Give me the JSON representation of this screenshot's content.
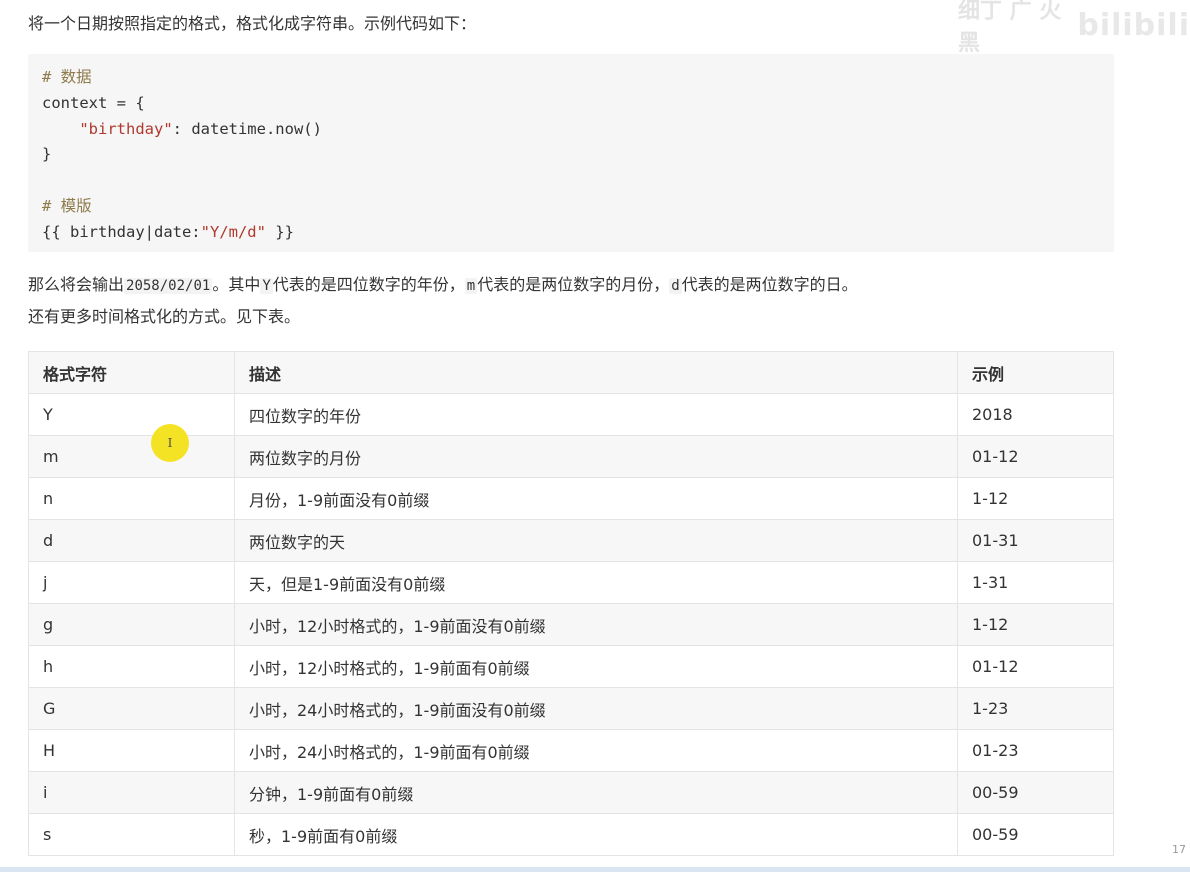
{
  "intro": "将一个日期按照指定的格式，格式化成字符串。示例代码如下：",
  "code": {
    "comment_data": "# 数据",
    "line_context": "context = {",
    "key_string": "\"birthday\"",
    "after_key": ": datetime.now()",
    "close_brace": "}",
    "comment_template": "# 模版",
    "template_prefix": "{{ birthday|date:",
    "template_string": "\"Y/m/d\"",
    "template_suffix": " }}"
  },
  "para1": {
    "t1": "那么将会输出",
    "c1": "2058/02/01",
    "t2": "。其中",
    "c2": "Y",
    "t3": "代表的是四位数字的年份，",
    "c3": "m",
    "t4": "代表的是两位数字的月份，",
    "c4": "d",
    "t5": "代表的是两位数字的日。"
  },
  "para2": "还有更多时间格式化的方式。见下表。",
  "table": {
    "headers": [
      "格式字符",
      "描述",
      "示例"
    ],
    "rows": [
      [
        "Y",
        "四位数字的年份",
        "2018"
      ],
      [
        "m",
        "两位数字的月份",
        "01-12"
      ],
      [
        "n",
        "月份，1-9前面没有0前缀",
        "1-12"
      ],
      [
        "d",
        "两位数字的天",
        "01-31"
      ],
      [
        "j",
        "天，但是1-9前面没有0前缀",
        "1-31"
      ],
      [
        "g",
        "小时，12小时格式的，1-9前面没有0前缀",
        "1-12"
      ],
      [
        "h",
        "小时，12小时格式的，1-9前面有0前缀",
        "01-12"
      ],
      [
        "G",
        "小时，24小时格式的，1-9前面没有0前缀",
        "1-23"
      ],
      [
        "H",
        "小时，24小时格式的，1-9前面有0前缀",
        "01-23"
      ],
      [
        "i",
        "分钟，1-9前面有0前缀",
        "00-59"
      ],
      [
        "s",
        "秒，1-9前面有0前缀",
        "00-59"
      ]
    ]
  },
  "cursor_glyph": "I",
  "watermark": {
    "text": "细丁 广 火 黑",
    "logo": "bilibili"
  },
  "page_number": "17",
  "colors": {
    "code_bg": "#f6f6f6",
    "comment": "#8e7b4b",
    "string": "#b03a2e",
    "cursor_highlight": "#f4e21a"
  }
}
